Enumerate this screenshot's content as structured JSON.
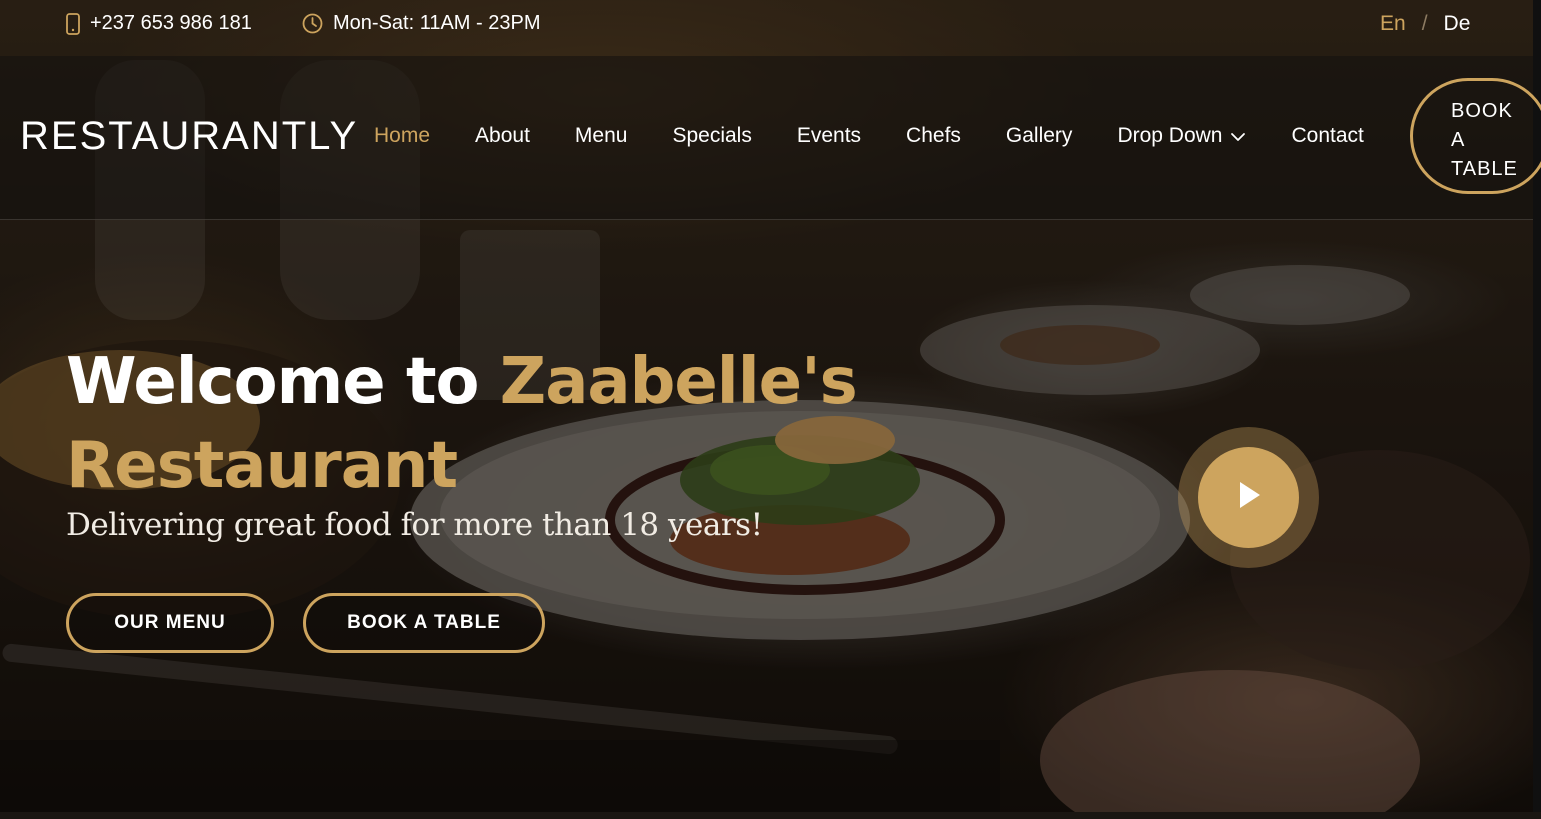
{
  "topbar": {
    "phone": "+237 653 986 181",
    "phone_icon": "phone-icon",
    "hours": "Mon-Sat: 11AM - 23PM",
    "hours_icon": "clock-icon",
    "languages": {
      "en": "En",
      "separator": "/",
      "de": "De"
    }
  },
  "header": {
    "logo": "RESTAURANTLY",
    "nav": {
      "home": "Home",
      "about": "About",
      "menu": "Menu",
      "specials": "Specials",
      "events": "Events",
      "chefs": "Chefs",
      "gallery": "Gallery",
      "dropdown": "Drop Down",
      "contact": "Contact"
    },
    "active_nav": "Home",
    "book_button": {
      "line1": "BOOK",
      "line2": "A",
      "line3": "TABLE"
    }
  },
  "hero": {
    "title_prefix": "Welcome to",
    "title_accent_line1": "Zaabelle's",
    "title_accent_line2": "Restaurant",
    "subtitle": "Delivering great food for more than 18 years!",
    "buttons": {
      "our_menu": "OUR MENU",
      "book_table": "BOOK A TABLE"
    },
    "play_icon": "play-icon"
  },
  "colors": {
    "accent": "#cda45e",
    "text": "#ffffff",
    "header_bg": "#12100e"
  }
}
